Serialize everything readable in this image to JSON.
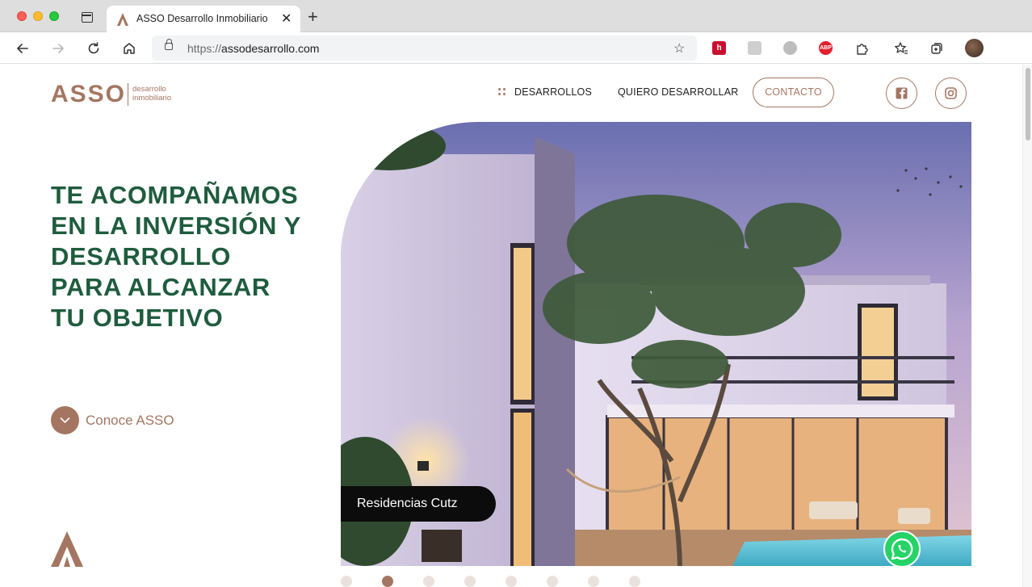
{
  "browser": {
    "tab_title": "ASSO Desarrollo Inmobiliario",
    "url_protocol": "https://",
    "url_domain": "assodesarrollo.com",
    "icons": [
      "back-icon",
      "forward-icon",
      "reload-icon",
      "home-icon",
      "lock-icon",
      "favorites-add-icon",
      "extensions-icon",
      "favorites-icon",
      "collections-icon",
      "profile-avatar"
    ],
    "extensions": [
      {
        "name": "h-extension",
        "label": "h",
        "color": "#c8102e"
      },
      {
        "name": "grey-extension",
        "label": "",
        "color": "#cfcfcf"
      },
      {
        "name": "circle-extension",
        "label": "",
        "color": "#bdbdbd"
      },
      {
        "name": "adblock-plus",
        "label": "ABP",
        "color": "#e41f2d"
      }
    ]
  },
  "site": {
    "logo_text": "ASSO",
    "logo_sub_1": "desarrollo",
    "logo_sub_2": "inmobiliario",
    "nav": {
      "desarrollos": "DESARROLLOS",
      "quiero": "QUIERO DESARROLLAR",
      "contacto": "CONTACTO"
    },
    "social": [
      "facebook-icon",
      "instagram-icon"
    ],
    "headline": [
      "TE ACOMPAÑAMOS",
      "EN LA INVERSIÓN Y",
      "DESARROLLO",
      "PARA ALCANZAR",
      "TU OBJETIVO"
    ],
    "cta_label": "Conoce ASSO",
    "hero_caption": "Residencias Cutz",
    "pager": {
      "total": 8,
      "active": 2
    },
    "colors": {
      "brand": "#a47661",
      "headline": "#1f5c3e",
      "whatsapp": "#25d366"
    }
  }
}
